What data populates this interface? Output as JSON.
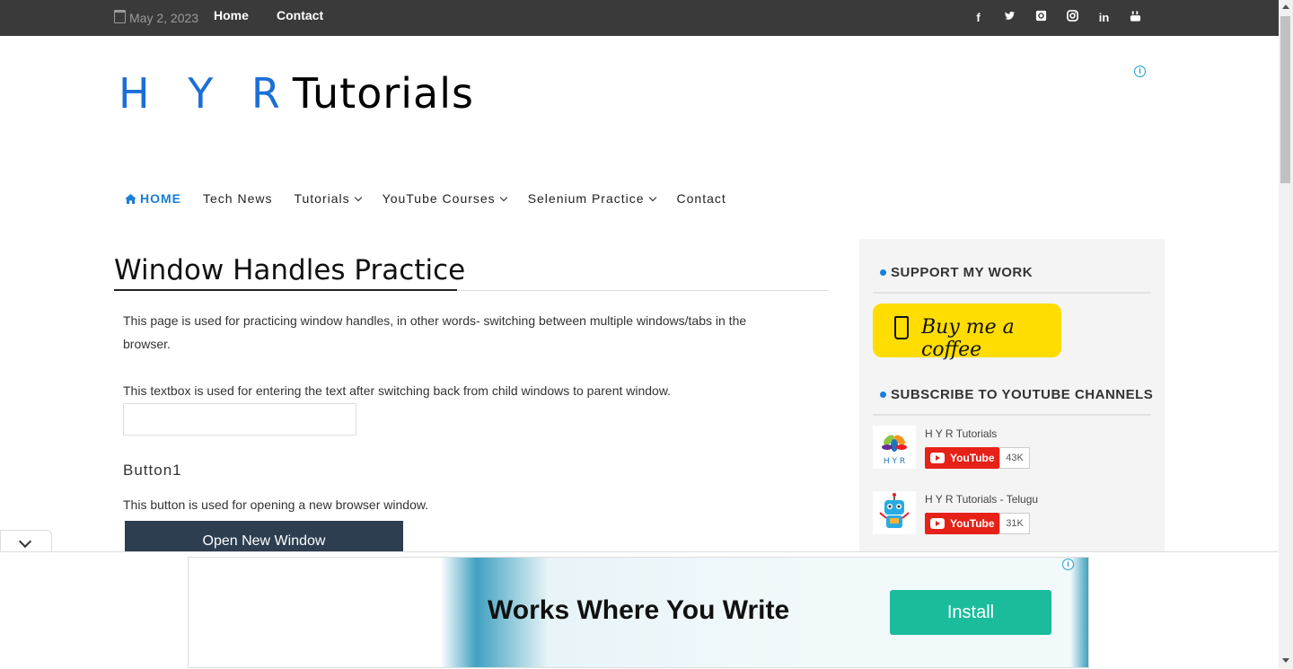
{
  "topbar": {
    "date": "May 2, 2023",
    "links": [
      "Home",
      "Contact"
    ],
    "social_icons": [
      "facebook-icon",
      "twitter-icon",
      "github-icon",
      "instagram-icon",
      "linkedin-icon",
      "youtube-icon"
    ]
  },
  "header": {
    "logo_hyr": "H Y R",
    "logo_tutorials": "Tutorials"
  },
  "nav": {
    "items": [
      {
        "label": "HOME",
        "icon": "home-icon"
      },
      {
        "label": "Tech News"
      },
      {
        "label": "Tutorials",
        "dropdown": true
      },
      {
        "label": "YouTube Courses",
        "dropdown": true
      },
      {
        "label": "Selenium Practice",
        "dropdown": true
      },
      {
        "label": "Contact"
      }
    ]
  },
  "main": {
    "title": "Window Handles Practice",
    "intro_line1": "This page is used for practicing window handles, in other words- switching between multiple windows/tabs in the",
    "intro_line2": "browser.",
    "textbox_desc": "This textbox is used for entering the text after switching back from child windows to parent window.",
    "textbox_value": "",
    "section_title": "Button1",
    "section_desc": "This button is used for opening a new browser window.",
    "button_label": "Open New Window"
  },
  "sidebar": {
    "support_title": "SUPPORT MY WORK",
    "coffee_label": "Buy me a coffee",
    "subscribe_title": "SUBSCRIBE TO YOUTUBE CHANNELS",
    "channels": [
      {
        "name": "H Y R Tutorials",
        "button": "YouTube",
        "count": "43K"
      },
      {
        "name": "H Y R Tutorials - Telugu",
        "button": "YouTube",
        "count": "31K"
      }
    ]
  },
  "ad": {
    "headline": "Works Where You Write",
    "cta": "Install"
  },
  "colors": {
    "topbar_bg": "#3a3a3a",
    "accent": "#1a7fd6",
    "button_bg": "#2c3e50",
    "coffee_bg": "#ffdd00",
    "youtube_red": "#e62117",
    "install_green": "#1abc9c"
  }
}
